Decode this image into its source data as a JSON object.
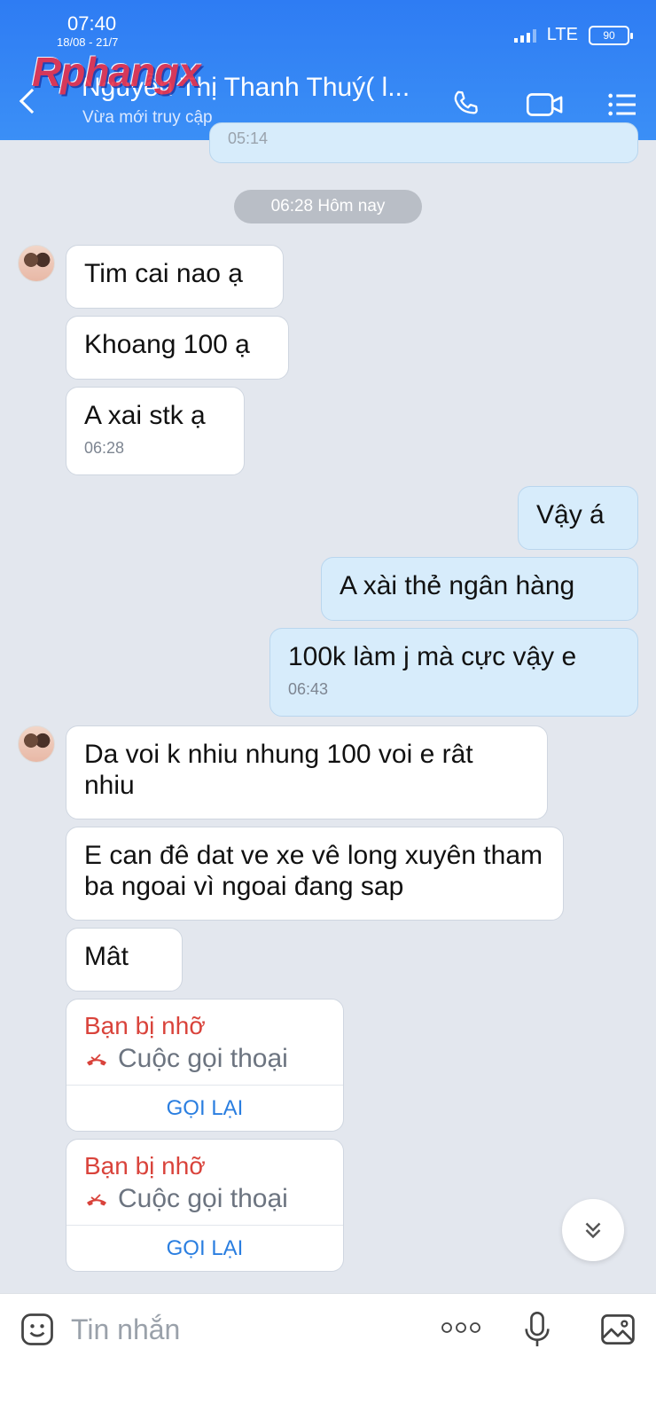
{
  "status_bar": {
    "time": "07:40",
    "date": "18/08 - 21/7",
    "network": "LTE",
    "battery": "90"
  },
  "header": {
    "watermark": "Rphangx",
    "contact_name": "Nguyễn Thị Thanh Thuý( l...",
    "status": "Vừa mới truy cập"
  },
  "chat": {
    "clipped_time": "05:14",
    "date_divider": "06:28 Hôm nay",
    "messages": [
      {
        "side": "in",
        "text": "Tim cai nao ạ"
      },
      {
        "side": "in",
        "text": "Khoang 100 ạ"
      },
      {
        "side": "in",
        "text": "A xai stk ạ",
        "time": "06:28"
      },
      {
        "side": "out",
        "text": "Vậy á"
      },
      {
        "side": "out",
        "text": "A xài thẻ ngân hàng"
      },
      {
        "side": "out",
        "text": "100k làm j mà cực vậy e",
        "time": "06:43"
      },
      {
        "side": "in",
        "text": "Da voi k nhiu nhung 100 voi e rât nhiu"
      },
      {
        "side": "in",
        "text": "E can đê dat ve xe vê long xuyên tham ba ngoai vì ngoai đang sap"
      },
      {
        "side": "in",
        "text": "Mât"
      }
    ],
    "missed_calls": [
      {
        "title": "Bạn bị nhỡ",
        "label": "Cuộc gọi thoại",
        "action": "GỌI LẠI"
      },
      {
        "title": "Bạn bị nhỡ",
        "label": "Cuộc gọi thoại",
        "action": "GỌI LẠI"
      }
    ]
  },
  "input_bar": {
    "placeholder": "Tin nhắn"
  },
  "colors": {
    "header": "#3b8ff6",
    "outgoing_bubble": "#d7ecfb",
    "missed": "#d9433b",
    "call_back": "#2a7ee0"
  }
}
